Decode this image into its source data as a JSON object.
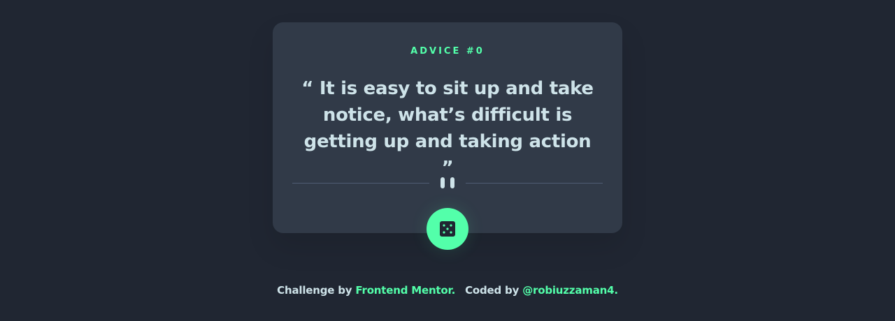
{
  "card": {
    "advice_label": "ADVICE #0",
    "quote_open": "“",
    "quote_text": "It is easy to sit up and take notice, what’s difficult is getting up and taking action",
    "quote_close": "”"
  },
  "actions": {
    "dice_icon": "dice-icon"
  },
  "footer": {
    "challenge_prefix": "Challenge by",
    "challenge_link": "Frontend Mentor.",
    "coded_prefix": "Coded by",
    "coded_link": "@robiuzzaman4."
  },
  "colors": {
    "background": "#202632",
    "card": "#313a48",
    "accent": "#53ffaa",
    "text": "#cee3e9",
    "divider": "#4f5d74"
  }
}
